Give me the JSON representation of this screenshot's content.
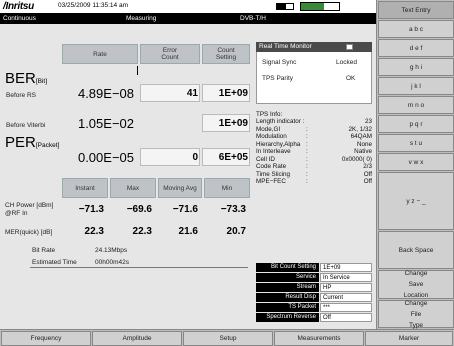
{
  "header": {
    "logo": "/Inritsu",
    "datetime": "03/25/2009 11:35:14 am",
    "mode": "Continuous",
    "state": "Measuring",
    "standard": "DVB-T/H"
  },
  "ber_table": {
    "headers": {
      "rate": "Rate",
      "error_count": "Error Count",
      "count_setting": "Count Setting"
    },
    "ber_label": "BER",
    "ber_sub": "[Bit]",
    "per_label": "PER",
    "per_sub": "[Packet]",
    "rows": [
      {
        "label": "Before RS",
        "rate": "4.89E−08",
        "error": "41",
        "setting": "1E+09"
      },
      {
        "label": "Before Viterbi",
        "rate": "1.05E−02",
        "error": "",
        "setting": "1E+09"
      },
      {
        "label": "",
        "rate": "0.00E−05",
        "error": "0",
        "setting": "6E+05"
      }
    ]
  },
  "power_table": {
    "headers": {
      "instant": "Instant",
      "max": "Max",
      "moving_avg": "Moving Avg",
      "min": "Min"
    },
    "rows": [
      {
        "label": "CH Power [dBm]\n@RF In",
        "label1": "CH Power [dBm]",
        "label2": "@RF In",
        "instant": "−71.3",
        "max": "−69.6",
        "avg": "−71.6",
        "min": "−73.3"
      },
      {
        "label1": "MER(quick) [dB]",
        "instant": "22.3",
        "max": "22.3",
        "avg": "21.6",
        "min": "20.7"
      }
    ],
    "bit_rate_label": "Bit Rate",
    "bit_rate_value": "24.13Mbps",
    "est_time_label": "Estimated Time",
    "est_time_value": "00h00m42s"
  },
  "realtime_monitor": {
    "title": "Real Time Monitor",
    "signal_sync_label": "Signal Sync",
    "signal_sync_value": "Locked",
    "tps_parity_label": "TPS Parity",
    "tps_parity_value": "OK"
  },
  "tps_info": {
    "title": "TPS Info:",
    "rows": [
      {
        "k": "Length indicator :",
        "v": "23"
      },
      {
        "k": "Mode,GI",
        "v": "2K, 1/32"
      },
      {
        "k": "Modulation",
        "v": "64QAM"
      },
      {
        "k": "Hierarchy,Alpha",
        "v": "None"
      },
      {
        "k": "In Interleave",
        "v": "Native"
      },
      {
        "k": "Cell ID",
        "v": "0x0000(   0)"
      },
      {
        "k": "Code Rate",
        "v": "2/3"
      },
      {
        "k": "Time Slicing",
        "v": "Off"
      },
      {
        "k": "MPE−FEC",
        "v": "Off"
      }
    ]
  },
  "settings": [
    {
      "k": "Bit Count Setting",
      "v": "1E+09"
    },
    {
      "k": "Service",
      "v": "In Service"
    },
    {
      "k": "Stream",
      "v": "HP"
    },
    {
      "k": "Result Disp",
      "v": "Current"
    },
    {
      "k": "TS Packet",
      "v": "***"
    },
    {
      "k": "Spectrum Reverse",
      "v": "Off"
    }
  ],
  "softkeys": {
    "text_entry": "Text Entry",
    "k1": "a b c",
    "k2": "d e f",
    "k3": "g h i",
    "k4": "j k l",
    "k5": "m n o",
    "k6": "p q r",
    "k7": "s t u",
    "k8": "v w x",
    "k9": "y z − _",
    "backspace": "Back Space",
    "change_save_1": "Change",
    "change_save_2": "Save",
    "change_save_3": "Location",
    "change_file_1": "Change",
    "change_file_2": "File",
    "change_file_3": "Type"
  },
  "bottom_menu": [
    "Frequency",
    "Amplitude",
    "Setup",
    "Measurements",
    "Marker"
  ]
}
